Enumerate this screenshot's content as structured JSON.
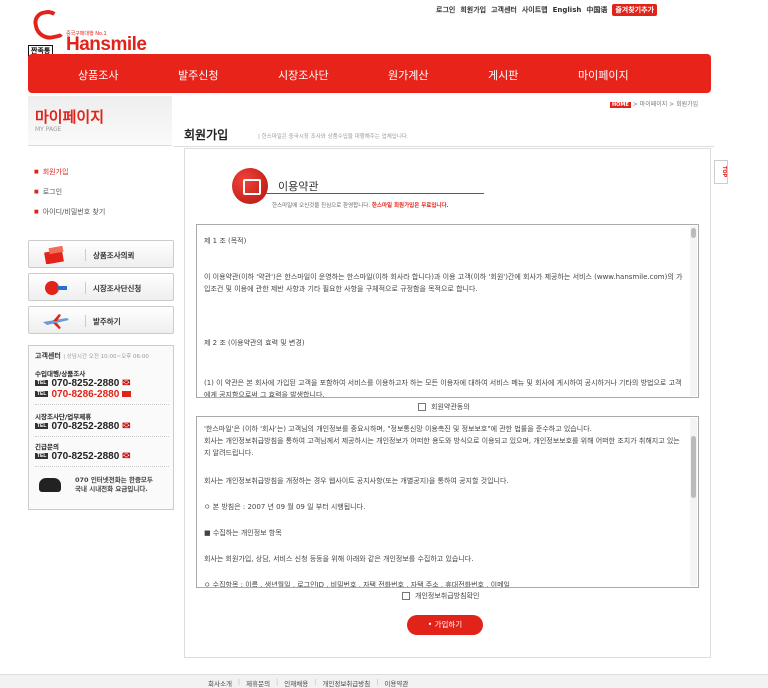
{
  "top_links": [
    "로그인",
    "회원가입",
    "고객센터",
    "사이트맵",
    "English",
    "中国语"
  ],
  "favorite_label": "즐겨찾기추가",
  "logo": {
    "tagline": "중국구매대행 No.1",
    "brand": "Hansmile",
    "chip": "짠족통"
  },
  "gnb": [
    "상품조사",
    "발주신청",
    "시장조사단",
    "원가계산",
    "게시판",
    "마이페이지"
  ],
  "mypage": {
    "title": "마이페이지",
    "subtitle": "MY PAGE"
  },
  "lnb": [
    "회원가입",
    "로그인",
    "아이디/비밀번호 찾기"
  ],
  "quick": [
    "상품조사의뢰",
    "시장조사단신청",
    "발주하기"
  ],
  "cs": {
    "title": "고객센터",
    "hours": "| 상담시간 오전 10:00~오후 06:00",
    "blocks": [
      {
        "name": "수입대행/상품조사",
        "tel": "070-8252-2880",
        "tel2": "070-8286-2880"
      },
      {
        "name": "시장조사단/업무제휴",
        "tel": "070-8252-2880"
      },
      {
        "name": "긴급문의",
        "tel": "070-8252-2880"
      }
    ],
    "tel_tag": "TEL",
    "foot1": "070 인터넷전화는 한중모두",
    "foot2": "국내 시내전화 요금입니다."
  },
  "breadcrumb": {
    "home": "HOME",
    "path": " > 마이페이지 > 회원가입"
  },
  "page": {
    "title": "회원가입",
    "desc": "| 한스마일은 중국시장 조사와 상품수입을 대행해주는 업체입니다."
  },
  "section": {
    "title": "이용약관",
    "desc": "한스마일에 오신것을 진심으로 환영합니다. ",
    "desc_red": "한스마일 회원가입은 무료입니다."
  },
  "terms": {
    "p1": "제 1 조 (목적)",
    "p2": "이 이용약관(이하 '약관')은 한스마일이 운영하는 한스마일(이하 회사라 합니다)과 이용 고객(이하 '회원')간에 회사가 제공하는 서비스 (www.hansmile.com)의 가입조건 및 이용에 관한 제반 사항과 기타 필요한 사항을 구체적으로 규정함을 목적으로 합니다.",
    "p3": "제 2 조 (이용약관의 효력 및 변경)",
    "p4": "(1) 이 약관은 본 회사에 가입된 고객을 포함하여 서비스를 이용하고자 하는 모든 이용자에 대하여 서비스 메뉴 및 회사에 게시하여 공시하거나 기타의 방법으로 고객에게 공지함으로써 그 효력을 발생합니다."
  },
  "agree1": "회원약관동의",
  "privacy": {
    "p1": "'한스마일'은 (이하 '회사'는) 고객님의 개인정보를 중요시하며, \"정보통신망 이용촉진 및 정보보호\"에 관한 법률을 준수하고 있습니다.",
    "p2": "회사는 개인정보취급방침을 통하여 고객님께서 제공하시는 개인정보가 어떠한 용도와 방식으로 이용되고 있으며, 개인정보보호를 위해 어떠한 조치가 취해지고 있는지 알려드립니다.",
    "p3": "회사는 개인정보취급방침을 개정하는 경우 웹사이트 공지사항(또는 개별공지)을 통하여 공지할 것입니다.",
    "p4": "ㅇ 본 방침은 : 2007 년 09 월 09 일 부터 시행됩니다.",
    "p5": "■ 수집하는 개인정보 항목",
    "p6": "회사는 회원가입, 상담, 서비스 신청 등등을 위해 아래와 같은 개인정보를 수집하고 있습니다.",
    "p7": "ㅇ 수집항목 : 이름 , 생년월일 , 로그인ID , 비밀번호 , 자택 전화번호 , 자택 주소 , 휴대전화번호 , 이메일"
  },
  "agree2": "개인정보취급방침확인",
  "join_button": "• 가입하기",
  "top_button": "TOP",
  "footer": [
    "회사소개",
    "제휴문의",
    "인재채용",
    "개인정보취급방침",
    "이용약관"
  ],
  "colors": {
    "brand_red": "#e2231a"
  }
}
